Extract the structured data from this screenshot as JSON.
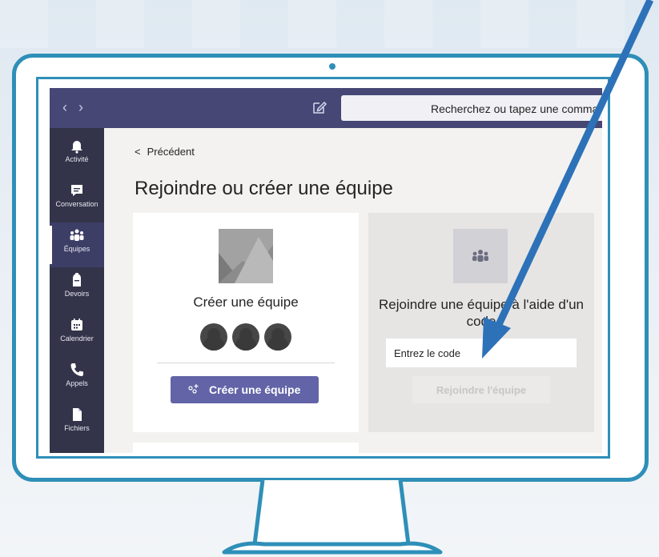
{
  "topbar": {
    "back_arrow": "‹",
    "forward_arrow": "›",
    "search_placeholder": "Recherchez ou tapez une comma"
  },
  "rail": {
    "items": [
      {
        "label": "Activité",
        "icon": "bell-icon"
      },
      {
        "label": "Conversation",
        "icon": "chat-icon"
      },
      {
        "label": "Équipes",
        "icon": "teams-icon",
        "active": true
      },
      {
        "label": "Devoirs",
        "icon": "backpack-icon"
      },
      {
        "label": "Calendrier",
        "icon": "calendar-icon"
      },
      {
        "label": "Appels",
        "icon": "phone-icon"
      },
      {
        "label": "Fichiers",
        "icon": "file-icon"
      }
    ]
  },
  "main": {
    "back_label": "Précédent",
    "page_title": "Rejoindre ou créer une équipe",
    "create_card": {
      "title": "Créer une équipe",
      "button_label": "Créer une équipe"
    },
    "join_card": {
      "title": "Rejoindre une équipe à l'aide d'un code",
      "code_placeholder": "Entrez le code",
      "button_label": "Rejoindre l'équipe"
    }
  },
  "colors": {
    "topbar": "#464775",
    "rail": "#33344a",
    "accent": "#6264a7",
    "frame": "#2e8fb8",
    "annotation_arrow": "#2d72b8"
  }
}
